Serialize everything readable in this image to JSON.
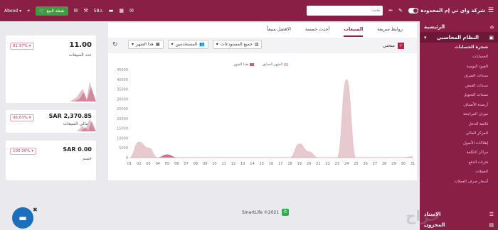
{
  "topbar": {
    "company": "شركة واي تي إم المحدودة",
    "search_placeholder": "بحث",
    "user": "Abood",
    "pos_label": "نقطة البيع",
    "badge": "58"
  },
  "sidebar": {
    "home": "الرئيسية",
    "erp": "النظام المحاسبي",
    "items": [
      "شجرة الحسابات",
      "الحسابات",
      "القيود اليومية",
      "سندات الصرف",
      "سندات القبض",
      "سندات التحويل",
      "أرصدة الأصناف",
      "ميزان المراجعة",
      "قائمة الدخل",
      "المركز المالي",
      "إهلاكات الأصول",
      "مراكز التكلفة",
      "فترات الدفع",
      "العملات",
      "أسعار صرف العملات"
    ],
    "extra1": "الاستاذ",
    "extra2": "المخزون"
  },
  "kpis": [
    {
      "value": "11.00",
      "label": "عدد المبيعات",
      "pct": "81.97%"
    },
    {
      "value": "SAR 2,370.85",
      "label": "إجمالي المبيعات",
      "pct": "96.63%"
    },
    {
      "value": "SAR 0.00",
      "label": "خصم",
      "pct": "100.00%"
    }
  ],
  "tabs": [
    "روابط سريعة",
    "المبيعات",
    "أحدث خمسة",
    "الافضل مبيعاً"
  ],
  "filters": {
    "checkbox_label": "منحني",
    "warehouses": "جميع المستودعات",
    "users": "المستخدمين",
    "period": "هذا الشهر"
  },
  "colors": {
    "brand": "#8a1f45",
    "this_month": "#c8637d",
    "last_month": "#e3bfc8"
  },
  "chart_data": {
    "type": "area",
    "x": [
      31,
      30,
      29,
      28,
      27,
      26,
      25,
      24,
      23,
      22,
      21,
      20,
      19,
      18,
      17,
      16,
      15,
      14,
      13,
      12,
      11,
      10,
      "09",
      "08",
      "07",
      "06",
      "05",
      "04",
      "03",
      "02",
      "01"
    ],
    "ylim": [
      0,
      45000
    ],
    "yticks": [
      "45000",
      "40000",
      "35000",
      "30000",
      "25000",
      "20000",
      "15000",
      "10000",
      "5000",
      "0"
    ],
    "series": [
      {
        "name": "هذا الشهر",
        "values": [
          0,
          0,
          0,
          0,
          0,
          0,
          0,
          0,
          0,
          0,
          0,
          0,
          0,
          0,
          0,
          0,
          0,
          0,
          0,
          0,
          0,
          0,
          0,
          0,
          0,
          0,
          1500,
          0,
          0,
          0,
          0
        ]
      },
      {
        "name": "الشهر السابق",
        "values": [
          500,
          0,
          0,
          0,
          0,
          0,
          0,
          40000,
          0,
          0,
          0,
          3000,
          7000,
          0,
          0,
          0,
          0,
          0,
          0,
          0,
          0,
          0,
          0,
          0,
          0,
          0,
          0,
          0,
          5000,
          8000,
          0
        ]
      }
    ],
    "legend": "top-center"
  },
  "footer": {
    "text": "SmartLife ©2021"
  }
}
